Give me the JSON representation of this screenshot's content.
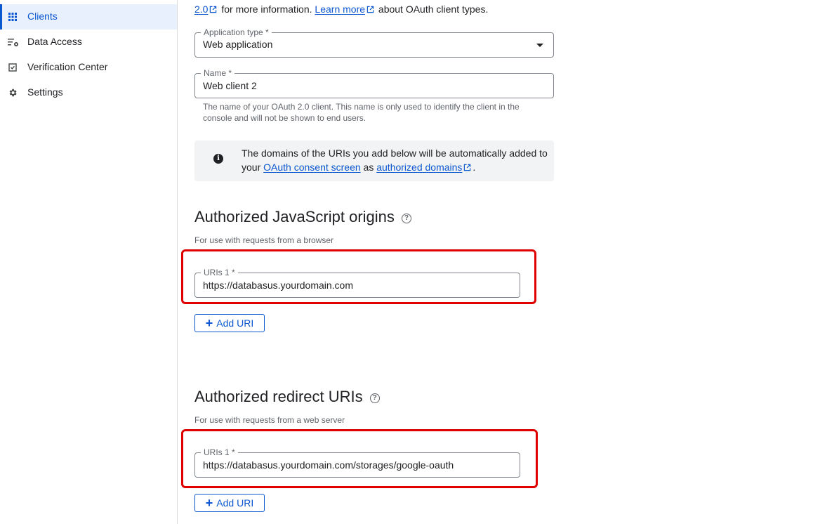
{
  "sidebar": {
    "items": [
      {
        "label": "Clients",
        "icon": "grid-icon",
        "active": true
      },
      {
        "label": "Data Access",
        "icon": "data-access-icon",
        "active": false
      },
      {
        "label": "Verification Center",
        "icon": "checkbox-icon",
        "active": false
      },
      {
        "label": "Settings",
        "icon": "gear-icon",
        "active": false
      }
    ]
  },
  "intro": {
    "link_version": "2.0",
    "text_more_info": "for more information.",
    "link_learn_more": "Learn more",
    "text_after": "about OAuth client types."
  },
  "form": {
    "application_type": {
      "label": "Application type *",
      "value": "Web application"
    },
    "name": {
      "label": "Name *",
      "value": "Web client 2"
    },
    "name_hint": "The name of your OAuth 2.0 client. This name is only used to identify the client in the console and will not be shown to end users."
  },
  "info": {
    "text_1": "The domains of the URIs you add below will be automatically added to your",
    "link_consent": "OAuth consent screen",
    "text_2": "as",
    "link_domains": "authorized domains",
    "text_3": "."
  },
  "js_origins": {
    "title": "Authorized JavaScript origins",
    "subtitle": "For use with requests from a browser",
    "uri_label": "URIs 1 *",
    "uri_value": "https://databasus.yourdomain.com",
    "add_label": "Add URI"
  },
  "redirect_uris": {
    "title": "Authorized redirect URIs",
    "subtitle": "For use with requests from a web server",
    "uri_label": "URIs 1 *",
    "uri_value": "https://databasus.yourdomain.com/storages/google-oauth",
    "add_label": "Add URI"
  },
  "colors": {
    "accent": "#0b57d0",
    "highlight": "#e00000",
    "info_bg": "#f1f3f4"
  }
}
